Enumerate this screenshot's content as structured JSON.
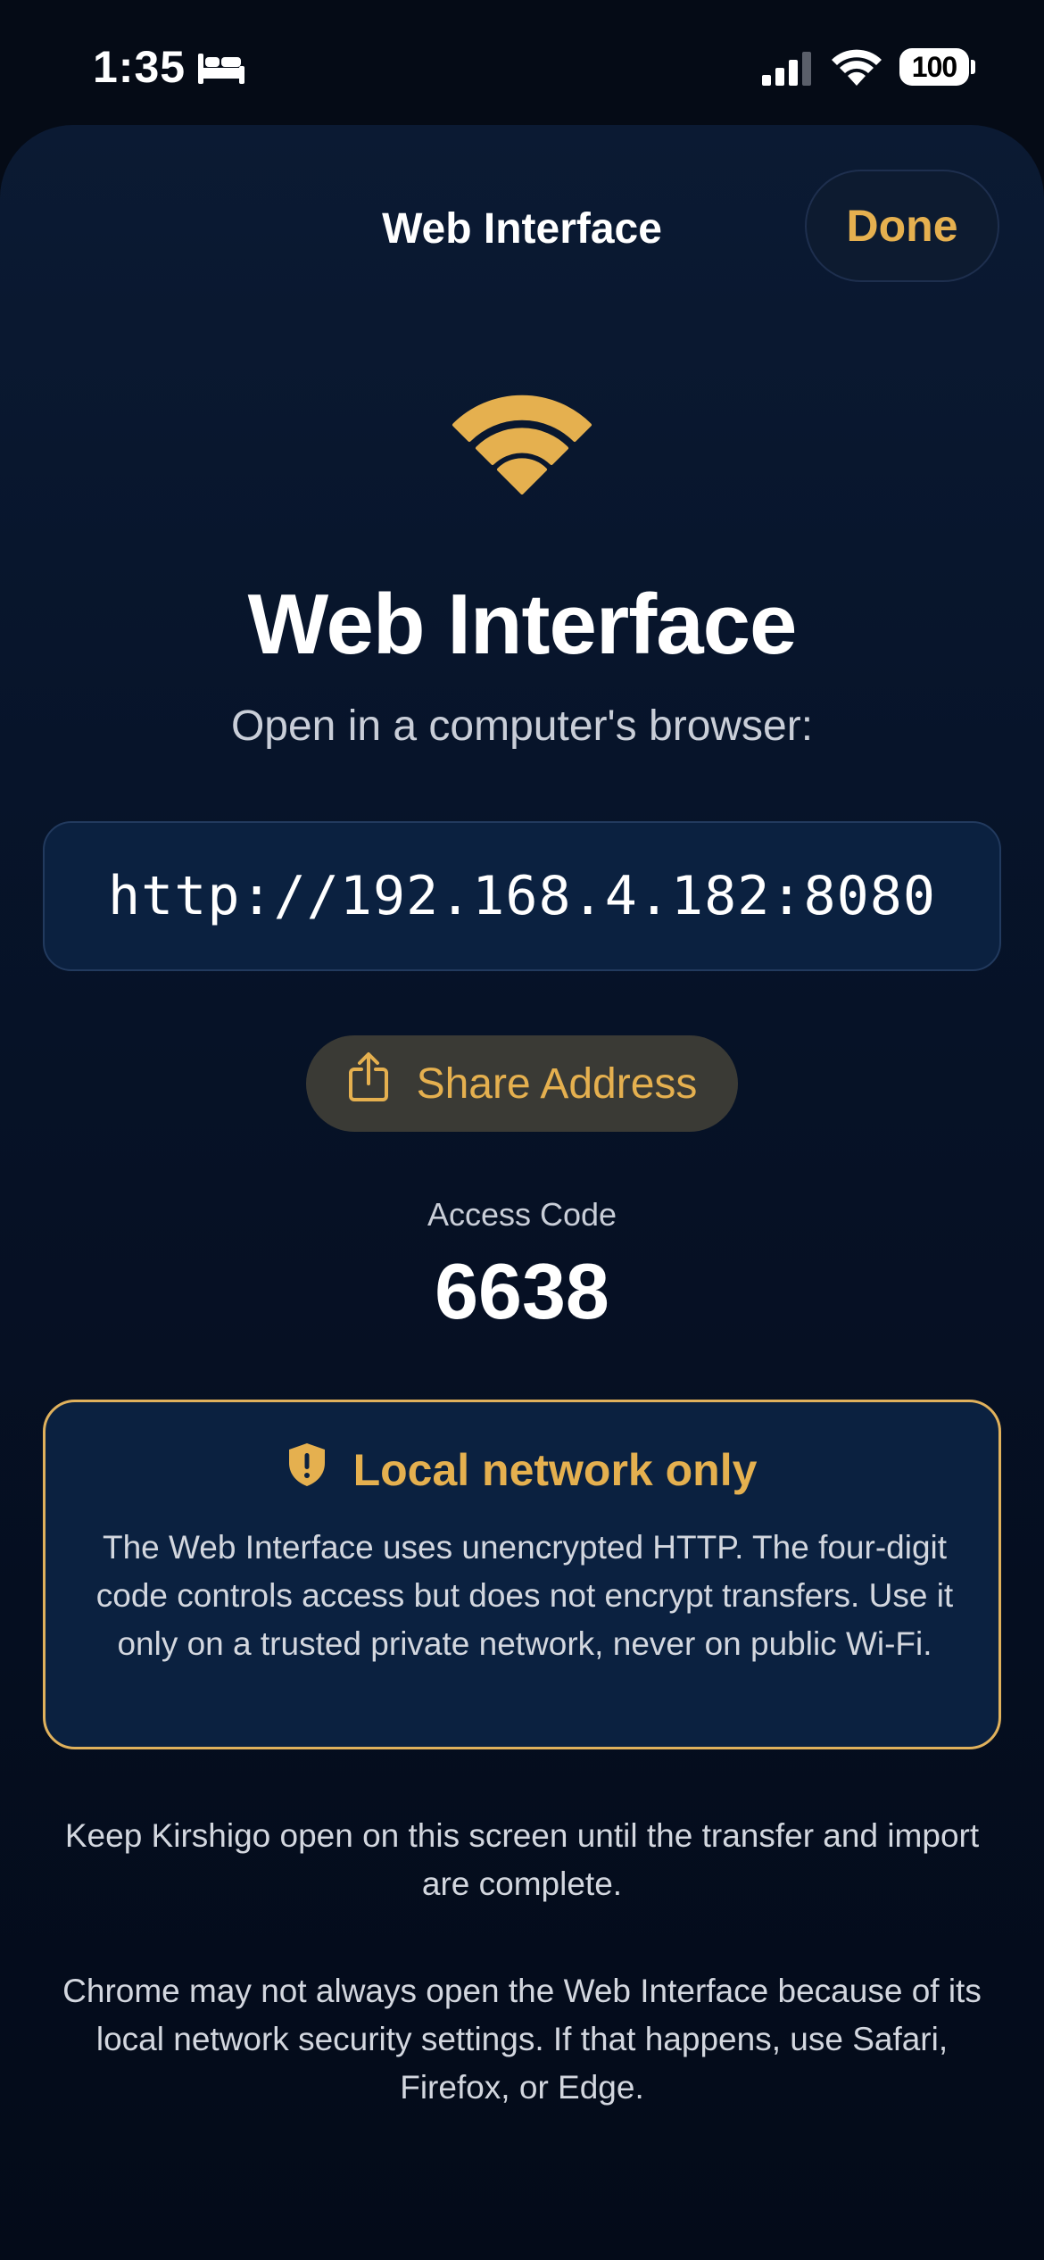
{
  "status_bar": {
    "time": "1:35",
    "battery": "100",
    "icons": [
      "bed-icon",
      "cellular-signal-icon",
      "wifi-icon",
      "battery-icon"
    ]
  },
  "nav": {
    "title": "Web Interface",
    "done_label": "Done"
  },
  "hero": {
    "icon": "wifi-icon",
    "title": "Web Interface",
    "subtitle": "Open in a computer's browser:"
  },
  "address": {
    "url": "http://192.168.4.182:8080",
    "share_label": "Share Address",
    "share_icon": "share-icon"
  },
  "access": {
    "label": "Access Code",
    "code": "6638"
  },
  "warning": {
    "icon": "shield-icon",
    "title": "Local network only",
    "body": "The Web Interface uses unencrypted HTTP. The four-digit code controls access but does not encrypt transfers. Use it only on a trusted private network, never on public Wi-Fi."
  },
  "info": [
    "Keep Kirshigo open on this screen until the transfer and import are complete.",
    "Chrome may not always open the Web Interface because of its local network security settings. If that happens, use Safari, Firefox, or Edge."
  ],
  "colors": {
    "accent": "#e5b04f",
    "background": "#050b16",
    "card": "#0b2140",
    "text": "#ffffff",
    "muted_text": "#d3d7df"
  }
}
